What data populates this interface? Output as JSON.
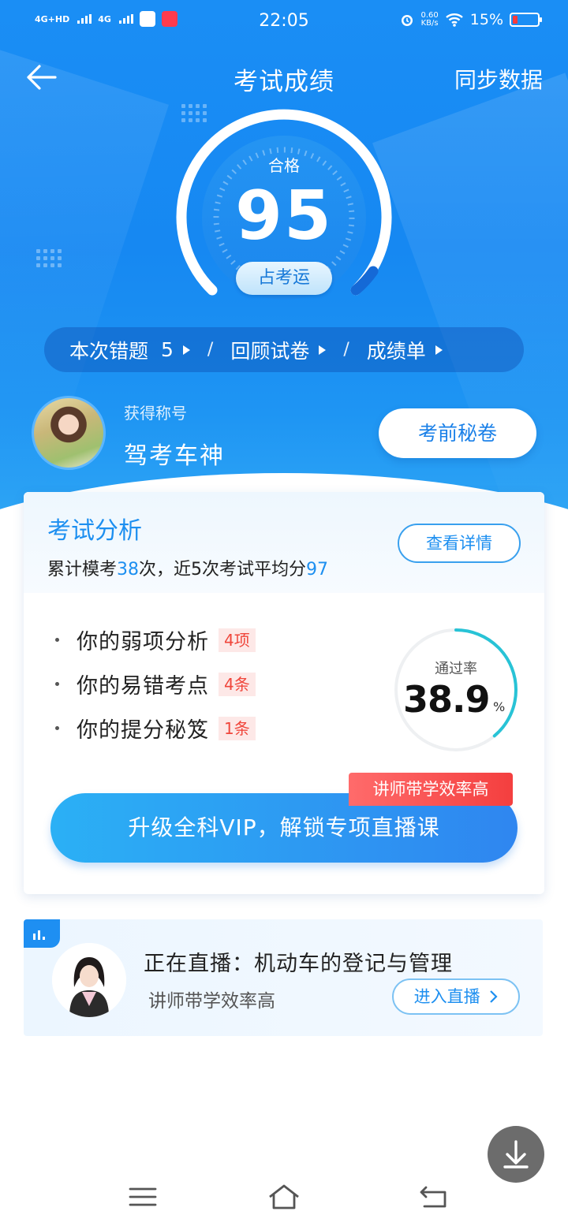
{
  "status_bar": {
    "network_1": "4G+HD",
    "network_2": "4G",
    "time": "22:05",
    "net_speed_value": "0.60",
    "net_speed_unit": "KB/s",
    "battery": "15%"
  },
  "nav": {
    "title": "考试成绩",
    "sync_label": "同步数据"
  },
  "score": {
    "qualification": "合格",
    "value": "95",
    "fortune_button": "占考运"
  },
  "quick_links": [
    {
      "label": "本次错题",
      "count": "5"
    },
    {
      "label": "回顾试卷"
    },
    {
      "label": "成绩单"
    }
  ],
  "quick_link_separator": "/",
  "profile": {
    "title_label": "获得称号",
    "title_value": "驾考车神",
    "secret_button": "考前秘卷"
  },
  "analysis": {
    "title": "考试分析",
    "summary_prefix": "累计模考",
    "exam_count": "38",
    "summary_middle": "次，近5次考试平均分",
    "avg_score": "97",
    "detail_button": "查看详情",
    "items": [
      {
        "label": "你的弱项分析",
        "badge": "4项"
      },
      {
        "label": "你的易错考点",
        "badge": "4条"
      },
      {
        "label": "你的提分秘笈",
        "badge": "1条"
      }
    ],
    "pass_rate_label": "通过率",
    "pass_rate_value": "38.9",
    "pass_rate_unit": "%",
    "pass_rate_fraction": 0.389,
    "vip_tag": "讲师带学效率高",
    "vip_button": "升级全科VIP，解锁专项直播课"
  },
  "live": {
    "title": "正在直播：机动车的登记与管理",
    "subtitle": "讲师带学效率高",
    "enter_button": "进入直播"
  },
  "colors": {
    "primary_blue": "#1d8ff0",
    "badge_red": "#f0463b",
    "ring_teal": "#28c3d6"
  }
}
